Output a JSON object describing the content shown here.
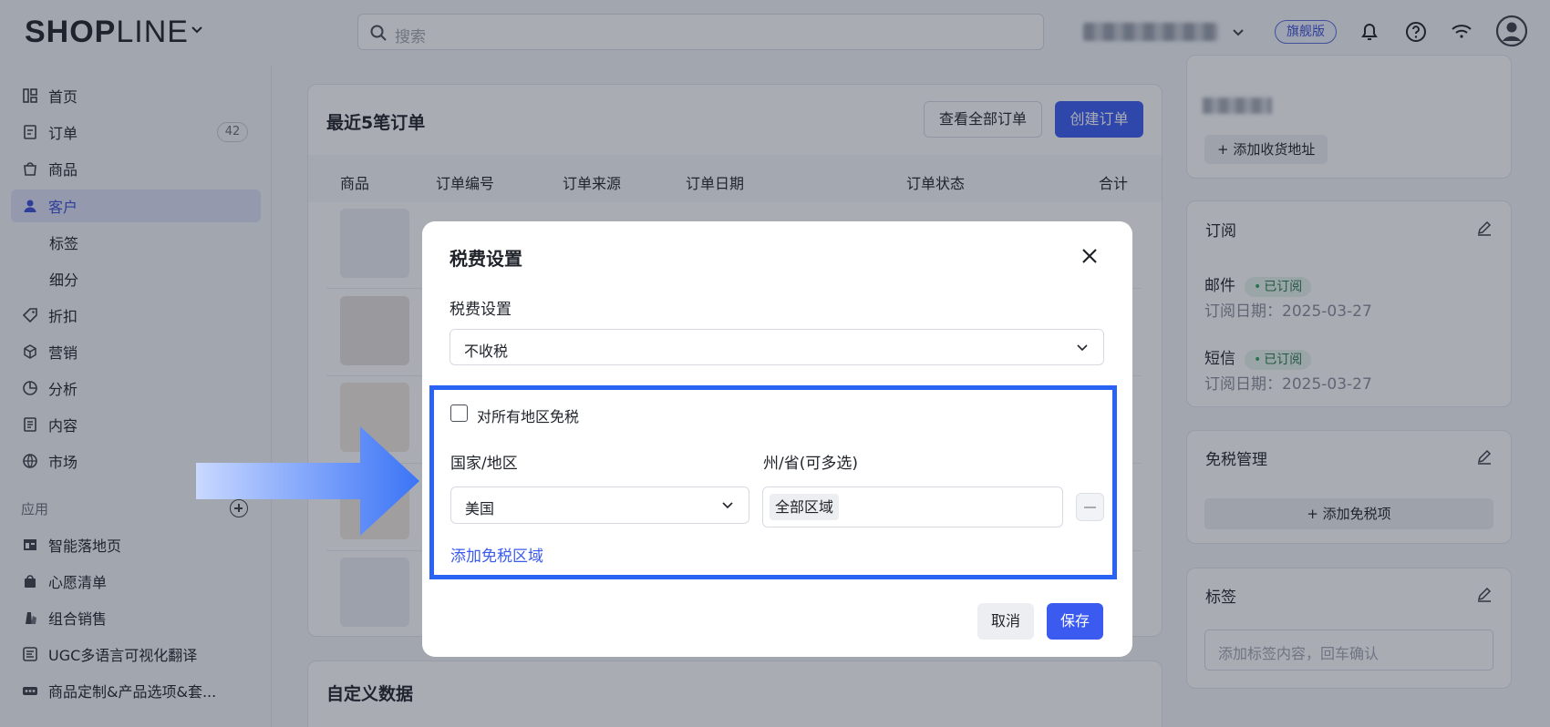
{
  "header": {
    "logo_bold": "SHOP",
    "logo_thin": "LINE",
    "search_placeholder": "搜索",
    "plan_badge": "旗舰版"
  },
  "sidebar": {
    "items": [
      {
        "label": "首页",
        "icon": "home-icon"
      },
      {
        "label": "订单",
        "icon": "order-icon",
        "count": "42"
      },
      {
        "label": "商品",
        "icon": "bag-icon"
      },
      {
        "label": "客户",
        "icon": "user-icon",
        "active": true
      },
      {
        "label": "标签"
      },
      {
        "label": "细分"
      },
      {
        "label": "折扣",
        "icon": "tag-icon"
      },
      {
        "label": "营销",
        "icon": "cube-icon"
      },
      {
        "label": "分析",
        "icon": "pie-chart-icon"
      },
      {
        "label": "内容",
        "icon": "document-icon"
      },
      {
        "label": "市场",
        "icon": "globe-icon"
      }
    ],
    "apps_label": "应用",
    "apps": [
      {
        "label": "智能落地页",
        "icon": "layout-icon"
      },
      {
        "label": "心愿清单",
        "icon": "gift-icon"
      },
      {
        "label": "组合销售",
        "icon": "bundle-icon"
      },
      {
        "label": "UGC多语言可视化翻译",
        "icon": "translate-icon"
      },
      {
        "label": "商品定制&产品选项&套...",
        "icon": "custom-icon"
      }
    ]
  },
  "orders_card": {
    "title": "最近5笔订单",
    "view_all": "查看全部订单",
    "create": "创建订单",
    "columns": [
      "商品",
      "订单编号",
      "订单来源",
      "订单日期",
      "订单状态",
      "合计"
    ]
  },
  "custom_data_title": "自定义数据",
  "right_panel": {
    "add_address": "+ 添加收货地址",
    "subscription_title": "订阅",
    "email_label": "邮件",
    "email_status": "已订阅",
    "email_date": "订阅日期：2025-03-27",
    "sms_label": "短信",
    "sms_status": "已订阅",
    "sms_date": "订阅日期：2025-03-27",
    "tax_exempt_title": "免税管理",
    "add_exempt": "+ 添加免税项",
    "tags_title": "标签",
    "tags_placeholder": "添加标签内容，回车确认"
  },
  "modal": {
    "title": "税费设置",
    "tax_label": "税费设置",
    "tax_value": "不收税",
    "exempt_all_label": "对所有地区免税",
    "country_label": "国家/地区",
    "country_value": "美国",
    "state_label": "州/省(可多选)",
    "state_chip": "全部区域",
    "add_region": "添加免税区域",
    "cancel": "取消",
    "save": "保存"
  },
  "colors": {
    "primary": "#3b5bf0",
    "highlight": "#2a63f3"
  }
}
